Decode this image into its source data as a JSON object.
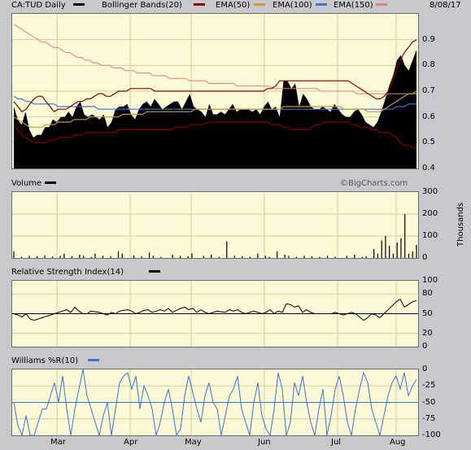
{
  "date": "8/08/17",
  "credit": "©BigCharts.com",
  "panel1": {
    "symbol_label": "CA:TUD Daily",
    "legend": [
      {
        "label": "Bollinger Bands(20)",
        "color": "#8a0000"
      },
      {
        "label": "EMA(50)",
        "color": "#c89a3a"
      },
      {
        "label": "EMA(100)",
        "color": "#3b73d6"
      },
      {
        "label": "EMA(150)",
        "color": "#e08080"
      }
    ],
    "yticks": [
      "0.9",
      "0.8",
      "0.7",
      "0.6",
      "0.5",
      "0.4"
    ]
  },
  "panel2": {
    "title": "Volume",
    "yticks": [
      "300",
      "200",
      "100",
      "0"
    ],
    "yunit": "Thousands"
  },
  "panel3": {
    "title": "Relative Strength Index(14)",
    "yticks": [
      "100",
      "80",
      "50",
      "20",
      "0"
    ]
  },
  "panel4": {
    "title": "Williams %R(10)",
    "yticks": [
      "0",
      "-25",
      "-50",
      "-75",
      "-100"
    ]
  },
  "xticks": [
    "Mar",
    "Apr",
    "May",
    "Jun",
    "Jul",
    "Aug"
  ],
  "chart_data": [
    {
      "type": "area",
      "title": "CA:TUD Daily",
      "ylim": [
        0.4,
        1.0
      ],
      "series": [
        {
          "name": "CA:TUD Daily",
          "values": [
            0.64,
            0.59,
            0.57,
            0.62,
            0.55,
            0.52,
            0.53,
            0.53,
            0.56,
            0.56,
            0.59,
            0.58,
            0.6,
            0.6,
            0.62,
            0.6,
            0.64,
            0.66,
            0.61,
            0.6,
            0.61,
            0.6,
            0.59,
            0.61,
            0.56,
            0.58,
            0.63,
            0.64,
            0.64,
            0.65,
            0.61,
            0.59,
            0.63,
            0.65,
            0.66,
            0.64,
            0.67,
            0.65,
            0.63,
            0.64,
            0.65,
            0.66,
            0.66,
            0.63,
            0.66,
            0.69,
            0.64,
            0.63,
            0.62,
            0.6,
            0.65,
            0.61,
            0.61,
            0.62,
            0.61,
            0.63,
            0.65,
            0.62,
            0.63,
            0.63,
            0.63,
            0.62,
            0.63,
            0.61,
            0.64,
            0.66,
            0.63,
            0.64,
            0.6,
            0.74,
            0.74,
            0.71,
            0.73,
            0.64,
            0.69,
            0.67,
            0.64,
            0.63,
            0.63,
            0.64,
            0.63,
            0.62,
            0.65,
            0.63,
            0.61,
            0.6,
            0.6,
            0.62,
            0.63,
            0.61,
            0.58,
            0.57,
            0.56,
            0.58,
            0.62,
            0.67,
            0.72,
            0.76,
            0.82,
            0.84,
            0.8,
            0.78,
            0.82,
            0.86
          ]
        },
        {
          "name": "Bollinger Bands(20)",
          "values": [
            0.66,
            0.64,
            0.62,
            0.63,
            0.65,
            0.67,
            0.68,
            0.68,
            0.66,
            0.64,
            0.62,
            0.63,
            0.63,
            0.63,
            0.64,
            0.65,
            0.66,
            0.66,
            0.67,
            0.67,
            0.68,
            0.69,
            0.69,
            0.68,
            0.68,
            0.69,
            0.7,
            0.7,
            0.7,
            0.71,
            0.71,
            0.71,
            0.71,
            0.71,
            0.71,
            0.7,
            0.7,
            0.7,
            0.7,
            0.7,
            0.7,
            0.7,
            0.7,
            0.7,
            0.7,
            0.7,
            0.7,
            0.7,
            0.7,
            0.7,
            0.7,
            0.7,
            0.7,
            0.7,
            0.7,
            0.7,
            0.7,
            0.7,
            0.7,
            0.7,
            0.7,
            0.7,
            0.7,
            0.71,
            0.71,
            0.72,
            0.74,
            0.74,
            0.74,
            0.74,
            0.74,
            0.74,
            0.74,
            0.74,
            0.74,
            0.74,
            0.74,
            0.74,
            0.74,
            0.74,
            0.74,
            0.74,
            0.74,
            0.74,
            0.73,
            0.72,
            0.71,
            0.7,
            0.69,
            0.68,
            0.67,
            0.67,
            0.68,
            0.7,
            0.74,
            0.78,
            0.82,
            0.85,
            0.87,
            0.89,
            0.9
          ]
        },
        {
          "name": "EMA(50)",
          "values": [
            0.6,
            0.59,
            0.58,
            0.57,
            0.56,
            0.56,
            0.56,
            0.56,
            0.57,
            0.57,
            0.57,
            0.58,
            0.58,
            0.58,
            0.58,
            0.59,
            0.59,
            0.59,
            0.59,
            0.6,
            0.6,
            0.6,
            0.6,
            0.6,
            0.6,
            0.6,
            0.6,
            0.61,
            0.61,
            0.61,
            0.61,
            0.61,
            0.61,
            0.62,
            0.62,
            0.62,
            0.62,
            0.62,
            0.62,
            0.62,
            0.62,
            0.62,
            0.62,
            0.62,
            0.62,
            0.63,
            0.63,
            0.63,
            0.63,
            0.63,
            0.63,
            0.63,
            0.63,
            0.63,
            0.63,
            0.63,
            0.63,
            0.63,
            0.63,
            0.63,
            0.63,
            0.63,
            0.63,
            0.63,
            0.63,
            0.63,
            0.63,
            0.64,
            0.64,
            0.64,
            0.64,
            0.64,
            0.64,
            0.64,
            0.64,
            0.64,
            0.64,
            0.64,
            0.64,
            0.64,
            0.64,
            0.64,
            0.63,
            0.63,
            0.63,
            0.63,
            0.63,
            0.63,
            0.62,
            0.62,
            0.62,
            0.62,
            0.63,
            0.64,
            0.65,
            0.66,
            0.67,
            0.68,
            0.69,
            0.69,
            0.7
          ]
        },
        {
          "name": "EMA(100)",
          "values": [
            0.68,
            0.67,
            0.67,
            0.66,
            0.66,
            0.65,
            0.65,
            0.65,
            0.65,
            0.65,
            0.65,
            0.64,
            0.64,
            0.64,
            0.64,
            0.64,
            0.64,
            0.64,
            0.64,
            0.64,
            0.64,
            0.63,
            0.63,
            0.63,
            0.63,
            0.63,
            0.63,
            0.63,
            0.63,
            0.63,
            0.63,
            0.63,
            0.63,
            0.63,
            0.63,
            0.63,
            0.63,
            0.63,
            0.63,
            0.63,
            0.63,
            0.63,
            0.63,
            0.63,
            0.63,
            0.63,
            0.63,
            0.63,
            0.63,
            0.63,
            0.63,
            0.63,
            0.63,
            0.63,
            0.63,
            0.63,
            0.63,
            0.63,
            0.63,
            0.63,
            0.63,
            0.63,
            0.63,
            0.63,
            0.63,
            0.63,
            0.63,
            0.63,
            0.63,
            0.63,
            0.63,
            0.63,
            0.63,
            0.63,
            0.63,
            0.63,
            0.63,
            0.63,
            0.63,
            0.63,
            0.63,
            0.63,
            0.63,
            0.63,
            0.63,
            0.63,
            0.63,
            0.63,
            0.63,
            0.63,
            0.63,
            0.63,
            0.63,
            0.63,
            0.63,
            0.64,
            0.64,
            0.64,
            0.65,
            0.65,
            0.65
          ]
        },
        {
          "name": "EMA(150)",
          "values": [
            0.96,
            0.95,
            0.94,
            0.93,
            0.92,
            0.91,
            0.9,
            0.89,
            0.89,
            0.88,
            0.87,
            0.87,
            0.86,
            0.85,
            0.85,
            0.84,
            0.83,
            0.83,
            0.82,
            0.82,
            0.81,
            0.81,
            0.8,
            0.8,
            0.8,
            0.79,
            0.79,
            0.79,
            0.78,
            0.78,
            0.78,
            0.77,
            0.77,
            0.77,
            0.77,
            0.76,
            0.76,
            0.76,
            0.76,
            0.75,
            0.75,
            0.75,
            0.75,
            0.75,
            0.74,
            0.74,
            0.74,
            0.74,
            0.74,
            0.73,
            0.73,
            0.73,
            0.73,
            0.73,
            0.73,
            0.73,
            0.72,
            0.72,
            0.72,
            0.72,
            0.72,
            0.72,
            0.72,
            0.72,
            0.72,
            0.71,
            0.71,
            0.71,
            0.71,
            0.71,
            0.71,
            0.71,
            0.71,
            0.71,
            0.71,
            0.71,
            0.71,
            0.7,
            0.7,
            0.7,
            0.7,
            0.7,
            0.7,
            0.7,
            0.7,
            0.7,
            0.69,
            0.69,
            0.69,
            0.69,
            0.69,
            0.69,
            0.69,
            0.69,
            0.69,
            0.69,
            0.69,
            0.69,
            0.69,
            0.69,
            0.69,
            0.69
          ]
        },
        {
          "name": "Bollinger Lower",
          "values": [
            0.57,
            0.55,
            0.53,
            0.52,
            0.51,
            0.5,
            0.5,
            0.5,
            0.5,
            0.51,
            0.51,
            0.52,
            0.52,
            0.52,
            0.52,
            0.53,
            0.53,
            0.53,
            0.54,
            0.54,
            0.54,
            0.54,
            0.54,
            0.54,
            0.54,
            0.54,
            0.55,
            0.55,
            0.55,
            0.55,
            0.55,
            0.55,
            0.55,
            0.55,
            0.55,
            0.55,
            0.55,
            0.55,
            0.55,
            0.55,
            0.56,
            0.56,
            0.56,
            0.56,
            0.57,
            0.57,
            0.57,
            0.57,
            0.58,
            0.58,
            0.58,
            0.58,
            0.58,
            0.58,
            0.58,
            0.58,
            0.58,
            0.58,
            0.58,
            0.58,
            0.58,
            0.58,
            0.58,
            0.58,
            0.57,
            0.57,
            0.57,
            0.56,
            0.56,
            0.55,
            0.55,
            0.55,
            0.55,
            0.55,
            0.56,
            0.57,
            0.57,
            0.58,
            0.58,
            0.58,
            0.58,
            0.58,
            0.58,
            0.58,
            0.57,
            0.57,
            0.56,
            0.56,
            0.56,
            0.55,
            0.55,
            0.54,
            0.54,
            0.54,
            0.53,
            0.52,
            0.5,
            0.49,
            0.49,
            0.48,
            0.48
          ]
        }
      ]
    },
    {
      "type": "bar",
      "title": "Volume",
      "ylabel": "Thousands",
      "ylim": [
        0,
        300
      ],
      "values": [
        30,
        0,
        5,
        0,
        10,
        0,
        8,
        0,
        12,
        0,
        6,
        0,
        10,
        20,
        0,
        8,
        0,
        15,
        10,
        0,
        5,
        20,
        0,
        10,
        0,
        8,
        0,
        30,
        20,
        0,
        0,
        12,
        0,
        8,
        0,
        25,
        10,
        0,
        5,
        0,
        0,
        15,
        0,
        10,
        0,
        8,
        20,
        0,
        0,
        10,
        0,
        15,
        0,
        5,
        0,
        75,
        0,
        10,
        0,
        8,
        0,
        5,
        0,
        20,
        0,
        10,
        5,
        0,
        30,
        0,
        15,
        10,
        0,
        5,
        0,
        10,
        0,
        8,
        0,
        5,
        0,
        10,
        0,
        5,
        0,
        0,
        10,
        0,
        15,
        0,
        5,
        8,
        0,
        40,
        20,
        80,
        100,
        55,
        20,
        70,
        90,
        200,
        20,
        30,
        60
      ]
    },
    {
      "type": "line",
      "title": "Relative Strength Index(14)",
      "ylim": [
        0,
        100
      ],
      "values": [
        50,
        48,
        45,
        50,
        42,
        40,
        42,
        44,
        46,
        48,
        50,
        52,
        54,
        56,
        52,
        60,
        54,
        50,
        50,
        54,
        53,
        52,
        50,
        48,
        52,
        50,
        54,
        55,
        56,
        54,
        50,
        52,
        55,
        56,
        52,
        54,
        56,
        54,
        58,
        52,
        55,
        58,
        60,
        56,
        58,
        52,
        56,
        52,
        50,
        52,
        54,
        53,
        52,
        56,
        54,
        56,
        52,
        50,
        52,
        54,
        52,
        50,
        52,
        56,
        50,
        54,
        52,
        65,
        64,
        60,
        62,
        52,
        56,
        52,
        50,
        50,
        50,
        50,
        50,
        52,
        50,
        48,
        50,
        52,
        50,
        45,
        40,
        44,
        50,
        48,
        44,
        50,
        56,
        62,
        68,
        72,
        60,
        64,
        68,
        70
      ]
    },
    {
      "type": "line",
      "title": "Williams %R(10)",
      "ylim": [
        -100,
        0
      ],
      "values": [
        -50,
        -85,
        -100,
        -70,
        -100,
        -100,
        -80,
        -60,
        -60,
        -40,
        -20,
        -50,
        -10,
        -60,
        -100,
        -60,
        -30,
        0,
        -40,
        -60,
        -80,
        -100,
        -70,
        -50,
        -100,
        -60,
        -20,
        -10,
        -5,
        -30,
        -10,
        -60,
        -25,
        -40,
        -60,
        -100,
        -80,
        -50,
        -30,
        -60,
        -100,
        -90,
        -40,
        -10,
        -35,
        -60,
        -80,
        -40,
        -20,
        -50,
        -60,
        -100,
        -70,
        -40,
        -30,
        -10,
        -60,
        -80,
        -100,
        -50,
        -20,
        -70,
        -90,
        -100,
        -60,
        -5,
        -30,
        -100,
        -80,
        -20,
        -40,
        -10,
        -50,
        -80,
        -100,
        -60,
        -30,
        -100,
        -70,
        -30,
        -10,
        -40,
        -80,
        -100,
        -60,
        -30,
        -5,
        -20,
        -60,
        -80,
        -100,
        -70,
        -40,
        -20,
        -10,
        -30,
        -5,
        -40,
        -25,
        -15
      ]
    }
  ]
}
